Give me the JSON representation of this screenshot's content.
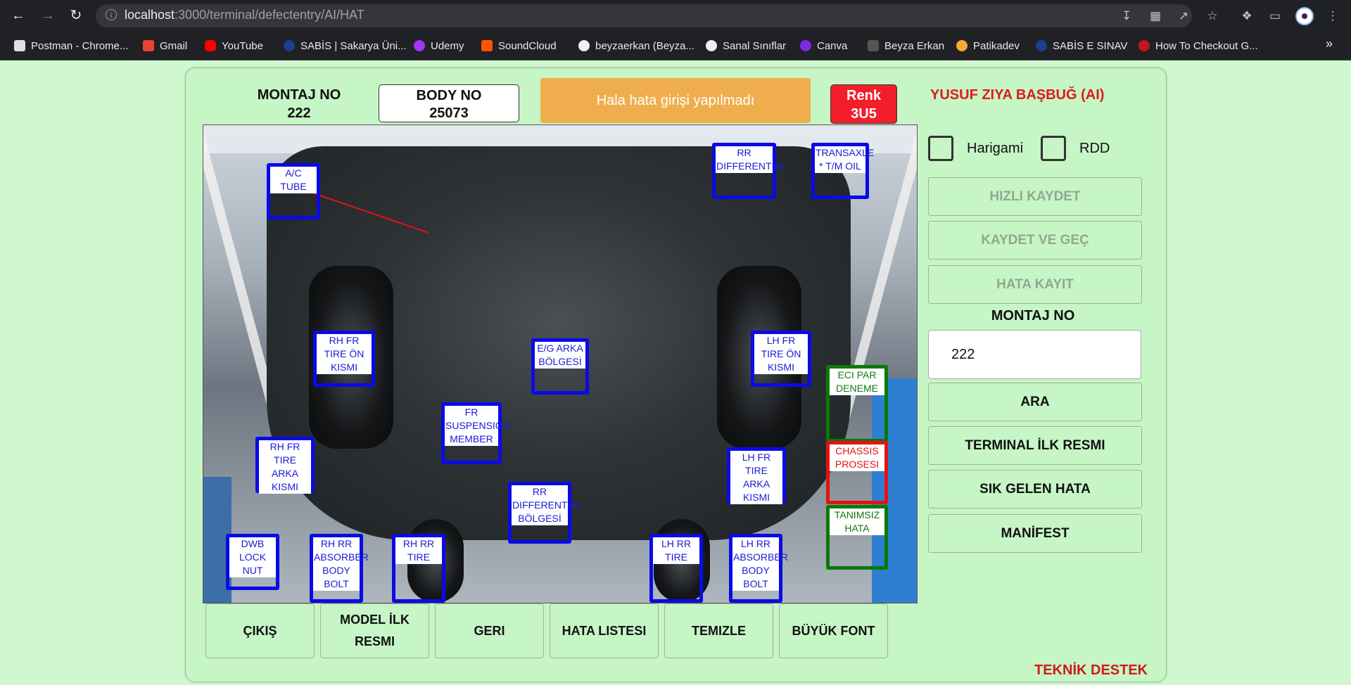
{
  "browser": {
    "url_host": "localhost",
    "url_path": ":3000/terminal/defectentry/AI/HAT",
    "bookmarks": [
      "Postman - Chrome...",
      "Gmail",
      "YouTube",
      "SABİS | Sakarya Üni...",
      "Udemy",
      "SoundCloud",
      "beyzaerkan (Beyza...",
      "Sanal Sınıflar",
      "Canva",
      "Beyza Erkan",
      "Patikadev",
      "SABİS E SINAV",
      "How To Checkout G..."
    ],
    "more": "»"
  },
  "header": {
    "montaj_label": "MONTAJ NO",
    "montaj_value": "222",
    "body_label": "BODY NO",
    "body_value": "25073",
    "status": "Hala hata girişi yapılmadı",
    "renk_label": "Renk",
    "renk_value": "3U5",
    "user": "YUSUF ZIYA BAŞBUĞ (AI)"
  },
  "defect_zones": [
    {
      "label": "A/C TUBE"
    },
    {
      "label": "RR DIFFERENTIAL"
    },
    {
      "label": "TRANSAXLE * T/M OIL"
    },
    {
      "label": "RH FR TIRE ÖN KISMI"
    },
    {
      "label": "E/G ARKA BÖLGESİ"
    },
    {
      "label": "LH FR TIRE ÖN KISMI"
    },
    {
      "label": "ECI PAR DENEME"
    },
    {
      "label": "FR SUSPENSION MEMBER"
    },
    {
      "label": "RH FR TIRE ARKA KISMI"
    },
    {
      "label": "CHASSIS PROSESI"
    },
    {
      "label": "LH FR TIRE ARKA KISMI"
    },
    {
      "label": "RR DIFFERENTIAL BÖLGESİ"
    },
    {
      "label": "TANIMSIZ HATA"
    },
    {
      "label": "DWB LOCK NUT"
    },
    {
      "label": "RH RR ABSORBER BODY BOLT"
    },
    {
      "label": "RH RR TIRE"
    },
    {
      "label": "LH RR TIRE"
    },
    {
      "label": "LH RR ABSORBER BODY BOLT"
    }
  ],
  "bottom_buttons": [
    "ÇIKIŞ",
    "MODEL İLK RESMI",
    "GERI",
    "HATA LISTESI",
    "TEMIZLE",
    "BÜYÜK FONT"
  ],
  "right": {
    "checkbox1": "Harigami",
    "checkbox2": "RDD",
    "hizli_kaydet": "HIZLI KAYDET",
    "kaydet_gec": "KAYDET VE GEÇ",
    "hata_kayit": "HATA KAYIT",
    "montaj_label": "MONTAJ NO",
    "montaj_input": "222",
    "ara": "ARA",
    "terminal_ilk_resmi": "TERMINAL İLK RESMI",
    "sik_gelen_hata": "SIK GELEN HATA",
    "manifest": "MANİFEST"
  },
  "footer": {
    "teknik_destek": "TEKNİK DESTEK"
  },
  "colors": {
    "page_bg": "#cff8cf",
    "status_bg": "#f0ad4e",
    "renk_bg": "#f21f2b",
    "zone_blue": "#0a0ae8",
    "zone_green": "#087a08",
    "zone_red": "#e41212"
  }
}
